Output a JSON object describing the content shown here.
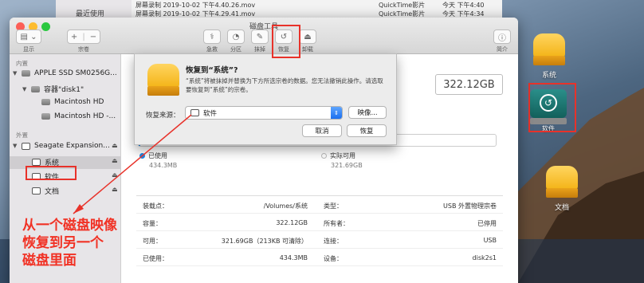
{
  "finder": {
    "sidebar_item": "最近使用",
    "rows": [
      {
        "name": "屏幕录制 2019-10-02 下午4.40.26.mov",
        "kind": "QuickTime影片",
        "date": "今天 下午4:40"
      },
      {
        "name": "屏幕录制 2019-10-02 下午4.29.41.mov",
        "kind": "QuickTime影片",
        "date": "今天 下午4:34"
      }
    ]
  },
  "window": {
    "title": "磁盘工具",
    "toolbar": {
      "display_label": "显示",
      "volume_label": "宗卷",
      "first_aid_label": "急救",
      "partition_label": "分区",
      "erase_label": "抹掉",
      "restore_label": "恢复",
      "unmount_label": "卸载",
      "info_label": "简介"
    }
  },
  "sidebar": {
    "internal_header": "内置",
    "external_header": "外置",
    "items": [
      {
        "label": "APPLE SSD SM0256G..."
      },
      {
        "label": "容器\"disk1\""
      },
      {
        "label": "Macintosh HD"
      },
      {
        "label": "Macintosh HD -..."
      },
      {
        "label": "Seagate Expansion..."
      },
      {
        "label": "系统"
      },
      {
        "label": "软件"
      },
      {
        "label": "文档"
      }
    ]
  },
  "main": {
    "capacity": "322.12GB",
    "legend": {
      "used_label": "已使用",
      "used_value": "434.3MB",
      "free_label": "实际可用",
      "free_value": "321.69GB"
    },
    "info_rows": [
      {
        "k1": "装载点：",
        "v1": "/Volumes/系统",
        "k2": "类型：",
        "v2": "USB 外置物理宗卷"
      },
      {
        "k1": "容量：",
        "v1": "322.12GB",
        "k2": "所有者：",
        "v2": "已停用"
      },
      {
        "k1": "可用：",
        "v1": "321.69GB（213KB 可清除）",
        "k2": "连接：",
        "v2": "USB"
      },
      {
        "k1": "已使用：",
        "v1": "434.3MB",
        "k2": "设备：",
        "v2": "disk2s1"
      }
    ]
  },
  "sheet": {
    "title": "恢复到“系统”?",
    "description": "“系统”将被抹掉并替换为下方所选宗卷的数据。您无法撤销此操作。请选取要恢复到“系统”的宗卷。",
    "source_label": "恢复来源：",
    "source_value": "软件",
    "image_button": "映像...",
    "cancel_button": "取消",
    "restore_button": "恢复"
  },
  "desktop": {
    "icons": [
      {
        "label": "系统"
      },
      {
        "label": "软件"
      },
      {
        "label": "文档"
      }
    ]
  },
  "annotation": {
    "text": "从一个磁盘映像\n恢复到另一个\n磁盘里面"
  },
  "colors": {
    "accent": "#1a6ff0",
    "annotation_red": "#f13225",
    "used_blue": "#1e88e5"
  }
}
